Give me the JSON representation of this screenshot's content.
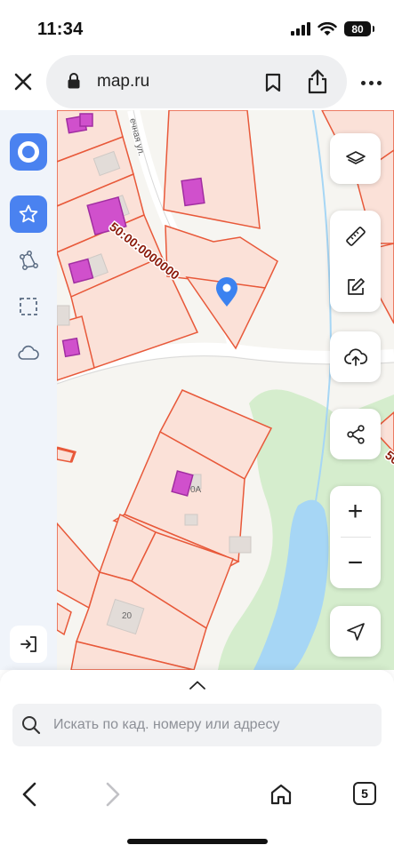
{
  "status_bar": {
    "time": "11:34",
    "battery": "80"
  },
  "browser": {
    "url": "map.ru"
  },
  "map": {
    "cadastral_label": "50:00:0000000",
    "cadastral_label_partial": "50",
    "street_label": "ечная ул.",
    "house_numbers": [
      "20",
      "0А"
    ],
    "colors": {
      "parcel_fill": "#fbe1d8",
      "parcel_stroke": "#e8593a",
      "building_fill": "#d050cc",
      "water": "#a6d6f5",
      "greenery": "#d5edcd",
      "road": "#ffffff",
      "marker": "#3b82f0"
    }
  },
  "sidebar": {
    "items": [
      {
        "icon": "logo-icon"
      },
      {
        "icon": "star-icon"
      },
      {
        "icon": "polygon-tool-icon"
      },
      {
        "icon": "select-area-icon"
      },
      {
        "icon": "cloud-icon"
      },
      {
        "icon": "sign-in-icon"
      }
    ]
  },
  "tools": {
    "zoom_in": "+",
    "zoom_out": "−"
  },
  "search": {
    "placeholder": "Искать по кад. номеру или адресу"
  },
  "navbar": {
    "tabs_count": "5"
  }
}
